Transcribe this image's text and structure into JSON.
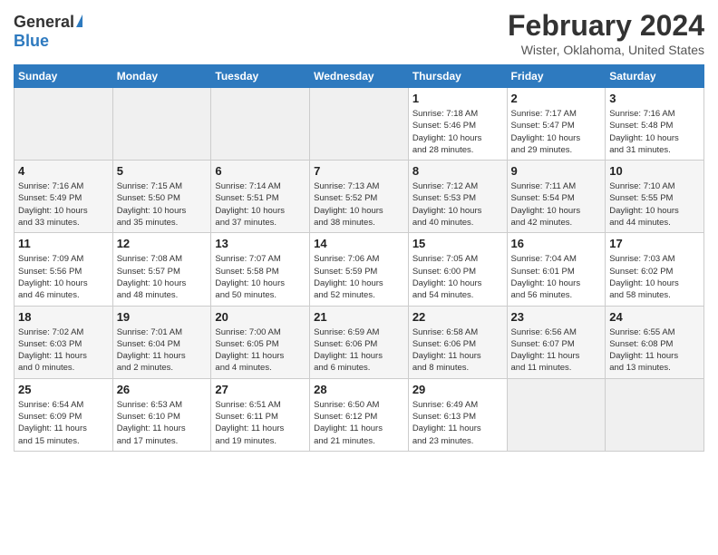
{
  "header": {
    "logo_general": "General",
    "logo_blue": "Blue",
    "title": "February 2024",
    "subtitle": "Wister, Oklahoma, United States"
  },
  "days_of_week": [
    "Sunday",
    "Monday",
    "Tuesday",
    "Wednesday",
    "Thursday",
    "Friday",
    "Saturday"
  ],
  "weeks": [
    [
      {
        "day": "",
        "info": ""
      },
      {
        "day": "",
        "info": ""
      },
      {
        "day": "",
        "info": ""
      },
      {
        "day": "",
        "info": ""
      },
      {
        "day": "1",
        "info": "Sunrise: 7:18 AM\nSunset: 5:46 PM\nDaylight: 10 hours\nand 28 minutes."
      },
      {
        "day": "2",
        "info": "Sunrise: 7:17 AM\nSunset: 5:47 PM\nDaylight: 10 hours\nand 29 minutes."
      },
      {
        "day": "3",
        "info": "Sunrise: 7:16 AM\nSunset: 5:48 PM\nDaylight: 10 hours\nand 31 minutes."
      }
    ],
    [
      {
        "day": "4",
        "info": "Sunrise: 7:16 AM\nSunset: 5:49 PM\nDaylight: 10 hours\nand 33 minutes."
      },
      {
        "day": "5",
        "info": "Sunrise: 7:15 AM\nSunset: 5:50 PM\nDaylight: 10 hours\nand 35 minutes."
      },
      {
        "day": "6",
        "info": "Sunrise: 7:14 AM\nSunset: 5:51 PM\nDaylight: 10 hours\nand 37 minutes."
      },
      {
        "day": "7",
        "info": "Sunrise: 7:13 AM\nSunset: 5:52 PM\nDaylight: 10 hours\nand 38 minutes."
      },
      {
        "day": "8",
        "info": "Sunrise: 7:12 AM\nSunset: 5:53 PM\nDaylight: 10 hours\nand 40 minutes."
      },
      {
        "day": "9",
        "info": "Sunrise: 7:11 AM\nSunset: 5:54 PM\nDaylight: 10 hours\nand 42 minutes."
      },
      {
        "day": "10",
        "info": "Sunrise: 7:10 AM\nSunset: 5:55 PM\nDaylight: 10 hours\nand 44 minutes."
      }
    ],
    [
      {
        "day": "11",
        "info": "Sunrise: 7:09 AM\nSunset: 5:56 PM\nDaylight: 10 hours\nand 46 minutes."
      },
      {
        "day": "12",
        "info": "Sunrise: 7:08 AM\nSunset: 5:57 PM\nDaylight: 10 hours\nand 48 minutes."
      },
      {
        "day": "13",
        "info": "Sunrise: 7:07 AM\nSunset: 5:58 PM\nDaylight: 10 hours\nand 50 minutes."
      },
      {
        "day": "14",
        "info": "Sunrise: 7:06 AM\nSunset: 5:59 PM\nDaylight: 10 hours\nand 52 minutes."
      },
      {
        "day": "15",
        "info": "Sunrise: 7:05 AM\nSunset: 6:00 PM\nDaylight: 10 hours\nand 54 minutes."
      },
      {
        "day": "16",
        "info": "Sunrise: 7:04 AM\nSunset: 6:01 PM\nDaylight: 10 hours\nand 56 minutes."
      },
      {
        "day": "17",
        "info": "Sunrise: 7:03 AM\nSunset: 6:02 PM\nDaylight: 10 hours\nand 58 minutes."
      }
    ],
    [
      {
        "day": "18",
        "info": "Sunrise: 7:02 AM\nSunset: 6:03 PM\nDaylight: 11 hours\nand 0 minutes."
      },
      {
        "day": "19",
        "info": "Sunrise: 7:01 AM\nSunset: 6:04 PM\nDaylight: 11 hours\nand 2 minutes."
      },
      {
        "day": "20",
        "info": "Sunrise: 7:00 AM\nSunset: 6:05 PM\nDaylight: 11 hours\nand 4 minutes."
      },
      {
        "day": "21",
        "info": "Sunrise: 6:59 AM\nSunset: 6:06 PM\nDaylight: 11 hours\nand 6 minutes."
      },
      {
        "day": "22",
        "info": "Sunrise: 6:58 AM\nSunset: 6:06 PM\nDaylight: 11 hours\nand 8 minutes."
      },
      {
        "day": "23",
        "info": "Sunrise: 6:56 AM\nSunset: 6:07 PM\nDaylight: 11 hours\nand 11 minutes."
      },
      {
        "day": "24",
        "info": "Sunrise: 6:55 AM\nSunset: 6:08 PM\nDaylight: 11 hours\nand 13 minutes."
      }
    ],
    [
      {
        "day": "25",
        "info": "Sunrise: 6:54 AM\nSunset: 6:09 PM\nDaylight: 11 hours\nand 15 minutes."
      },
      {
        "day": "26",
        "info": "Sunrise: 6:53 AM\nSunset: 6:10 PM\nDaylight: 11 hours\nand 17 minutes."
      },
      {
        "day": "27",
        "info": "Sunrise: 6:51 AM\nSunset: 6:11 PM\nDaylight: 11 hours\nand 19 minutes."
      },
      {
        "day": "28",
        "info": "Sunrise: 6:50 AM\nSunset: 6:12 PM\nDaylight: 11 hours\nand 21 minutes."
      },
      {
        "day": "29",
        "info": "Sunrise: 6:49 AM\nSunset: 6:13 PM\nDaylight: 11 hours\nand 23 minutes."
      },
      {
        "day": "",
        "info": ""
      },
      {
        "day": "",
        "info": ""
      }
    ]
  ]
}
